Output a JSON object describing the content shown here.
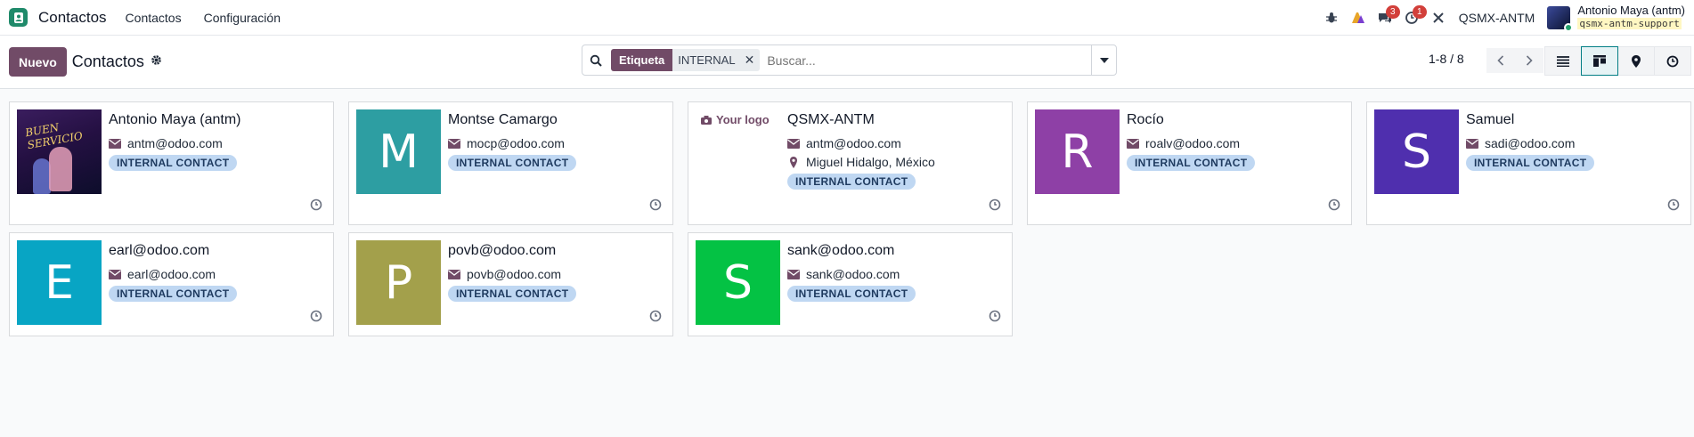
{
  "navbar": {
    "brand": "Contactos",
    "menu": [
      "Contactos",
      "Configuración"
    ],
    "chat_badge": "3",
    "activity_badge": "1",
    "company": "QSMX-ANTM",
    "user_name": "Antonio Maya (antm)",
    "db_name": "qsmx-antm-support"
  },
  "control": {
    "new_label": "Nuevo",
    "title": "Contactos",
    "facet_label": "Etiqueta",
    "facet_value": "INTERNAL",
    "search_placeholder": "Buscar...",
    "pager": "1-8 / 8"
  },
  "cards": [
    {
      "name": "Antonio Maya (antm)",
      "email": "antm@odoo.com",
      "tag": "INTERNAL CONTACT",
      "avatar_type": "photo",
      "photo_text": "BUEN SERVICIO"
    },
    {
      "name": "Montse Camargo",
      "email": "mocp@odoo.com",
      "tag": "INTERNAL CONTACT",
      "initial": "M",
      "color": "#2d9ea2"
    },
    {
      "name": "QSMX-ANTM",
      "email": "antm@odoo.com",
      "location": "Miguel Hidalgo, México",
      "tag": "INTERNAL CONTACT",
      "avatar_type": "logo",
      "logo_text": "Your logo"
    },
    {
      "name": "Rocío",
      "email": "roalv@odoo.com",
      "tag": "INTERNAL CONTACT",
      "initial": "R",
      "color": "#8e40a6"
    },
    {
      "name": "Samuel",
      "email": "sadi@odoo.com",
      "tag": "INTERNAL CONTACT",
      "initial": "S",
      "color": "#4f2fae"
    },
    {
      "name": "earl@odoo.com",
      "email": "earl@odoo.com",
      "tag": "INTERNAL CONTACT",
      "initial": "E",
      "color": "#08a5c4"
    },
    {
      "name": "povb@odoo.com",
      "email": "povb@odoo.com",
      "tag": "INTERNAL CONTACT",
      "initial": "P",
      "color": "#a3a04b"
    },
    {
      "name": "sank@odoo.com",
      "email": "sank@odoo.com",
      "tag": "INTERNAL CONTACT",
      "initial": "S",
      "color": "#04c244"
    }
  ]
}
